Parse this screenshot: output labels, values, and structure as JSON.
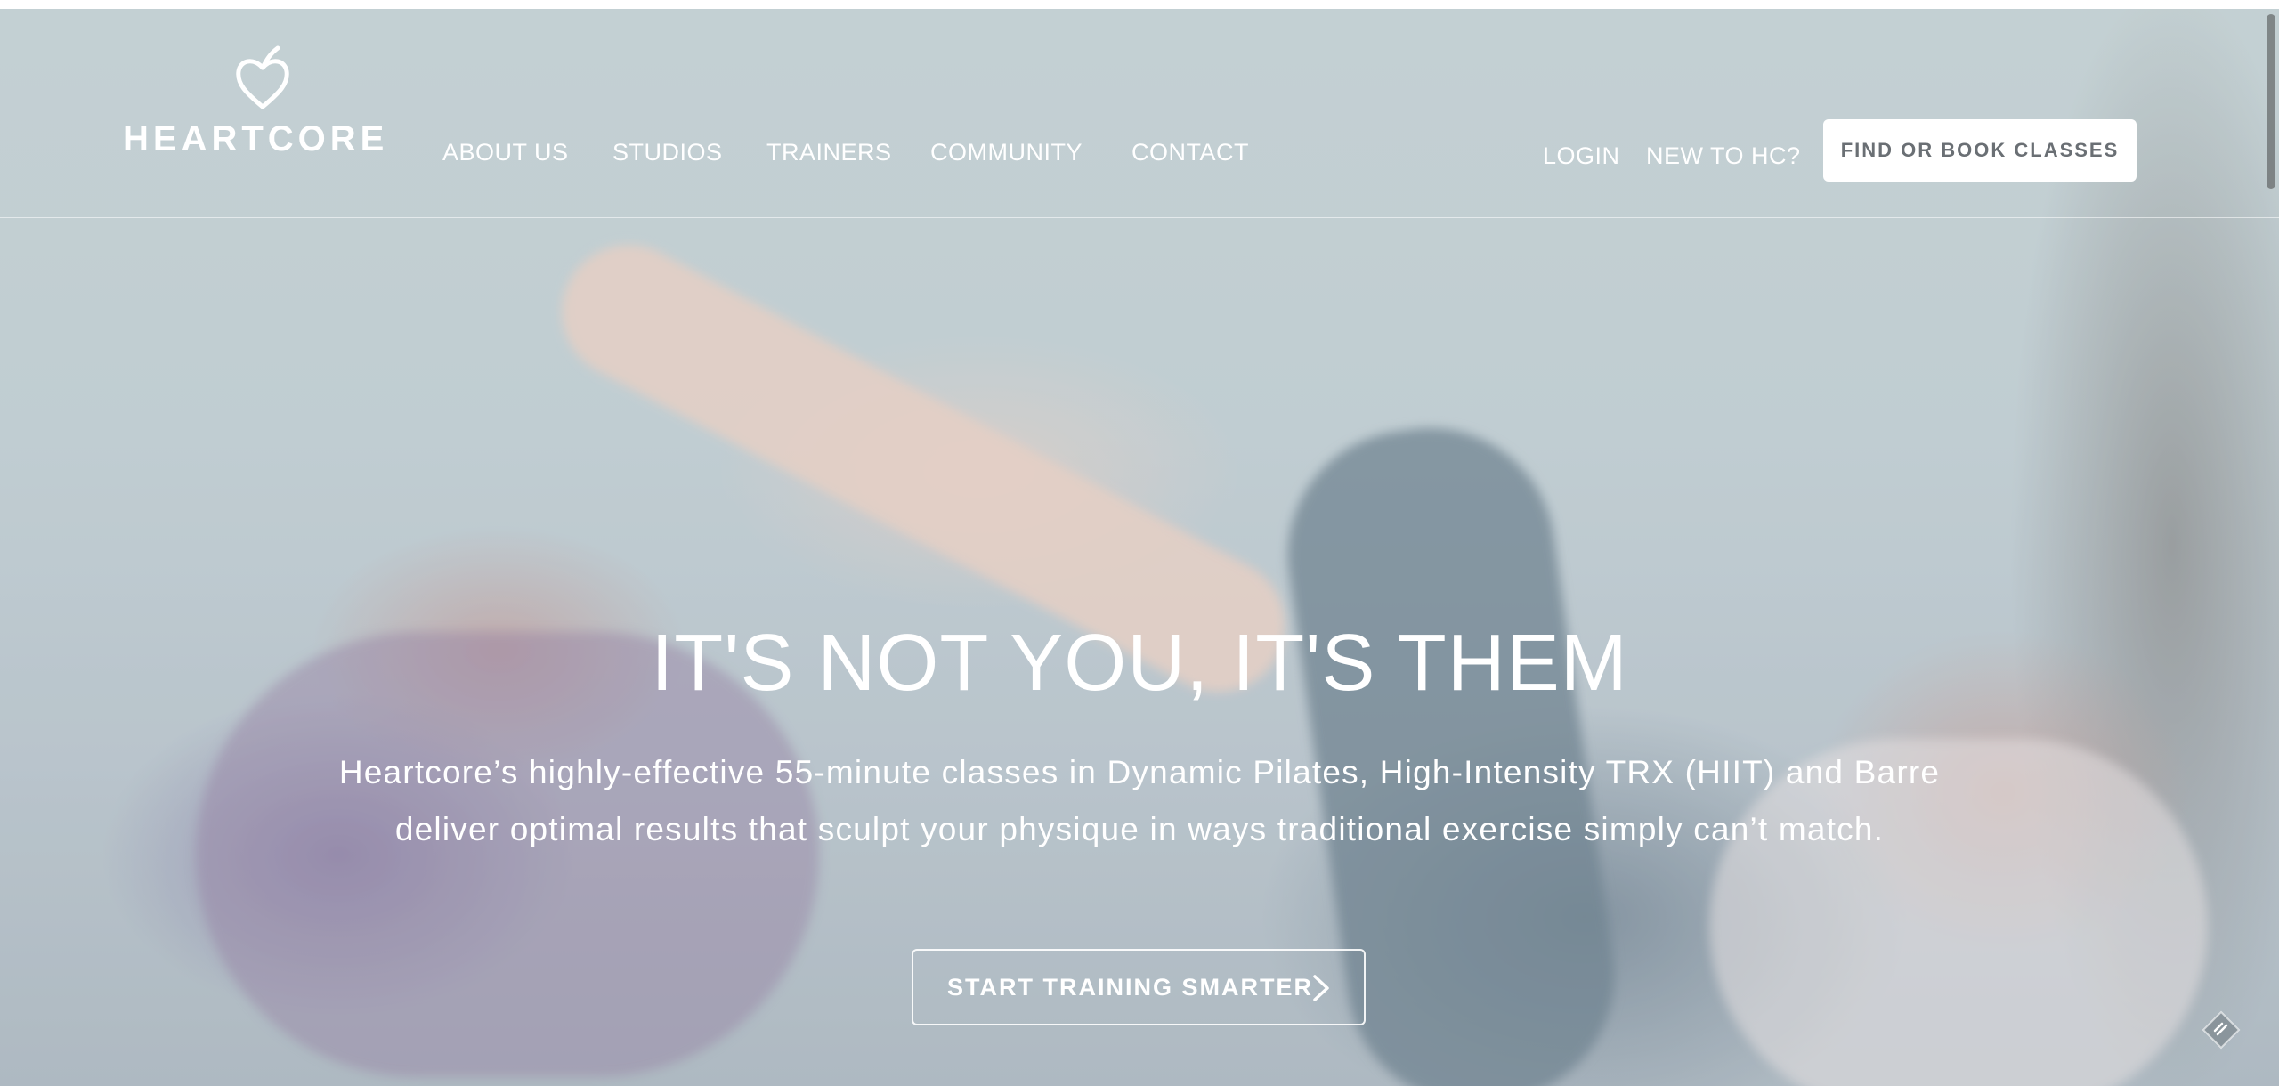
{
  "brand": {
    "name": "HEARTCORE",
    "logo_icon": "heart-logo-icon"
  },
  "nav": {
    "items": [
      {
        "label": "ABOUT US"
      },
      {
        "label": "STUDIOS"
      },
      {
        "label": "TRAINERS"
      },
      {
        "label": "COMMUNITY"
      },
      {
        "label": "CONTACT"
      }
    ],
    "login_label": "LOGIN",
    "new_label": "NEW TO HC?",
    "book_label": "FIND OR BOOK CLASSES"
  },
  "hero": {
    "title": "IT'S NOT YOU, IT'S THEM",
    "subtitle_line1": "Heartcore’s highly-effective 55-minute classes in Dynamic Pilates, High-Intensity TRX (HIIT) and Barre",
    "subtitle_line2": "deliver optimal results that sculpt your physique in ways traditional exercise simply can’t match.",
    "cta_label": "START TRAINING SMARTER",
    "cta_icon": "chevron-right-icon"
  },
  "widgets": {
    "corner_icon": "diamond-badge-icon"
  },
  "colors": {
    "text_light": "#ffffff",
    "button_bg": "#ffffff",
    "button_text": "#6a6f74"
  }
}
